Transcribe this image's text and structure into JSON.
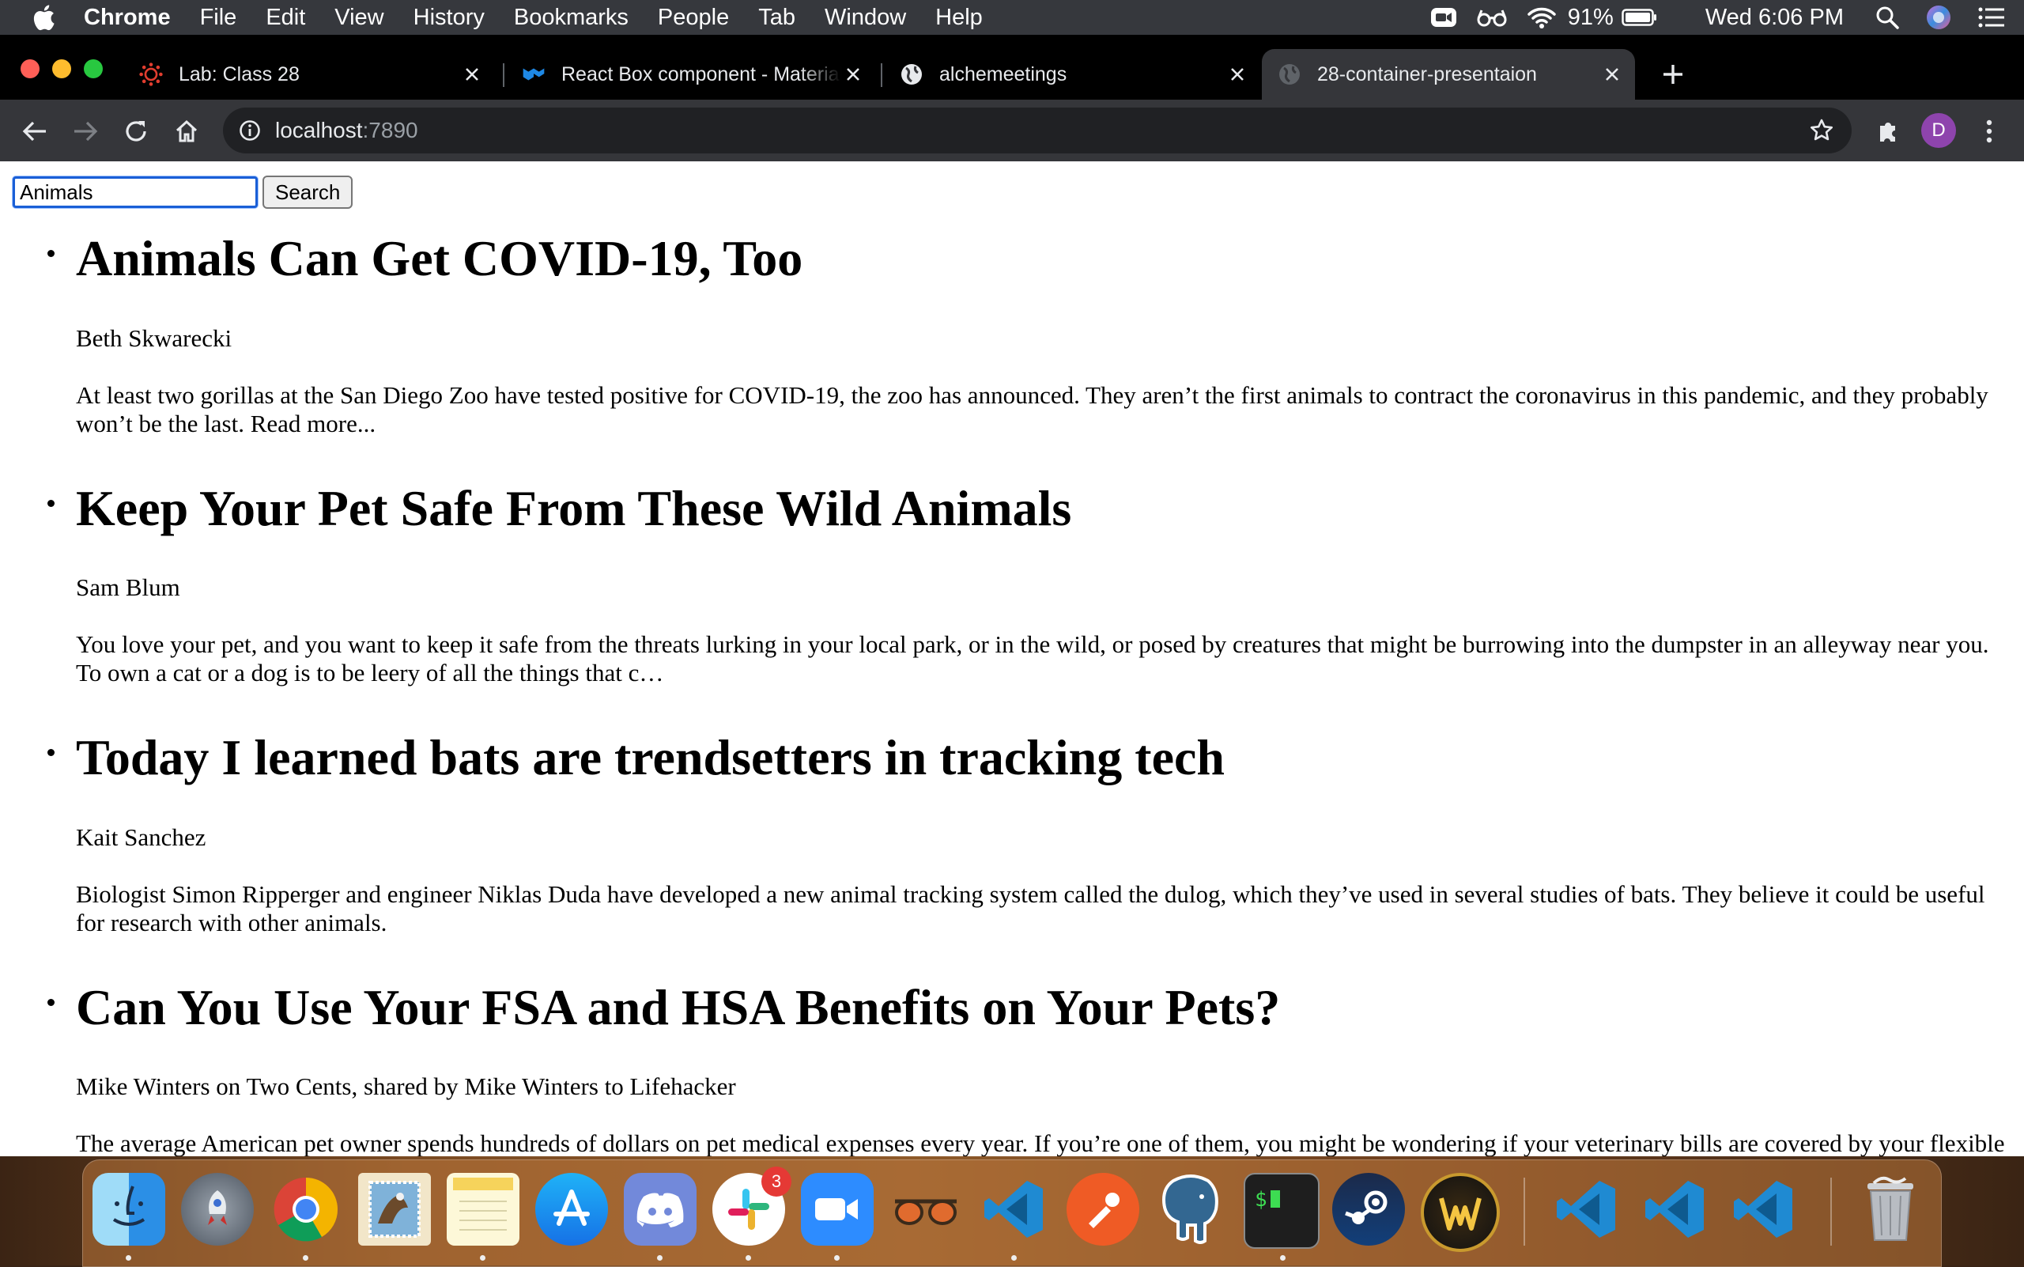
{
  "menubar": {
    "app_name": "Chrome",
    "items": [
      "File",
      "Edit",
      "View",
      "History",
      "Bookmarks",
      "People",
      "Tab",
      "Window",
      "Help"
    ],
    "battery": "91%",
    "clock": "Wed 6:06 PM"
  },
  "tabs": [
    {
      "title": "Lab: Class 28",
      "icon": "canvas-icon"
    },
    {
      "title": "React Box component - Material-UI",
      "icon": "material-ui-icon"
    },
    {
      "title": "alchemeetings",
      "icon": "globe-icon"
    },
    {
      "title": "28-container-presentaion",
      "icon": "globe-icon",
      "active": true
    }
  ],
  "toolbar": {
    "url_host": "localhost",
    "url_port": ":7890",
    "profile_initial": "D"
  },
  "search": {
    "value": "Animals",
    "button_label": "Search"
  },
  "articles": [
    {
      "title": "Animals Can Get COVID-19, Too",
      "author": "Beth Skwarecki",
      "description": "At least two gorillas at the San Diego Zoo have tested positive for COVID-19, the zoo has announced. They aren’t the first animals to contract the coronavirus in this pandemic, and they probably won’t be the last. Read more..."
    },
    {
      "title": "Keep Your Pet Safe From These Wild Animals",
      "author": "Sam Blum",
      "description": "You love your pet, and you want to keep it safe from the threats lurking in your local park, or in the wild, or posed by creatures that might be burrowing into the dumpster in an alleyway near you. To own a cat or a dog is to be leery of all the things that c…"
    },
    {
      "title": "Today I learned bats are trendsetters in tracking tech",
      "author": "Kait Sanchez",
      "description": "Biologist Simon Ripperger and engineer Niklas Duda have developed a new animal tracking system called the dulog, which they’ve used in several studies of bats. They believe it could be useful for research with other animals."
    },
    {
      "title": "Can You Use Your FSA and HSA Benefits on Your Pets?",
      "author": "Mike Winters on Two Cents, shared by Mike Winters to Lifehacker",
      "description": "The average American pet owner spends hundreds of dollars on pet medical expenses every year. If you’re one of them, you might be wondering if your veterinary bills are covered by your flexible spending account (FSA) or your health savings account (HSA). The …"
    }
  ],
  "dock": {
    "slack_badge": "3"
  },
  "colors": {
    "menubar": "#36383d",
    "tabstrip": "#000000",
    "toolbar": "#35363a",
    "omnibox": "#202124",
    "focus_ring": "#1a5fd6",
    "avatar": "#8e44ad"
  }
}
